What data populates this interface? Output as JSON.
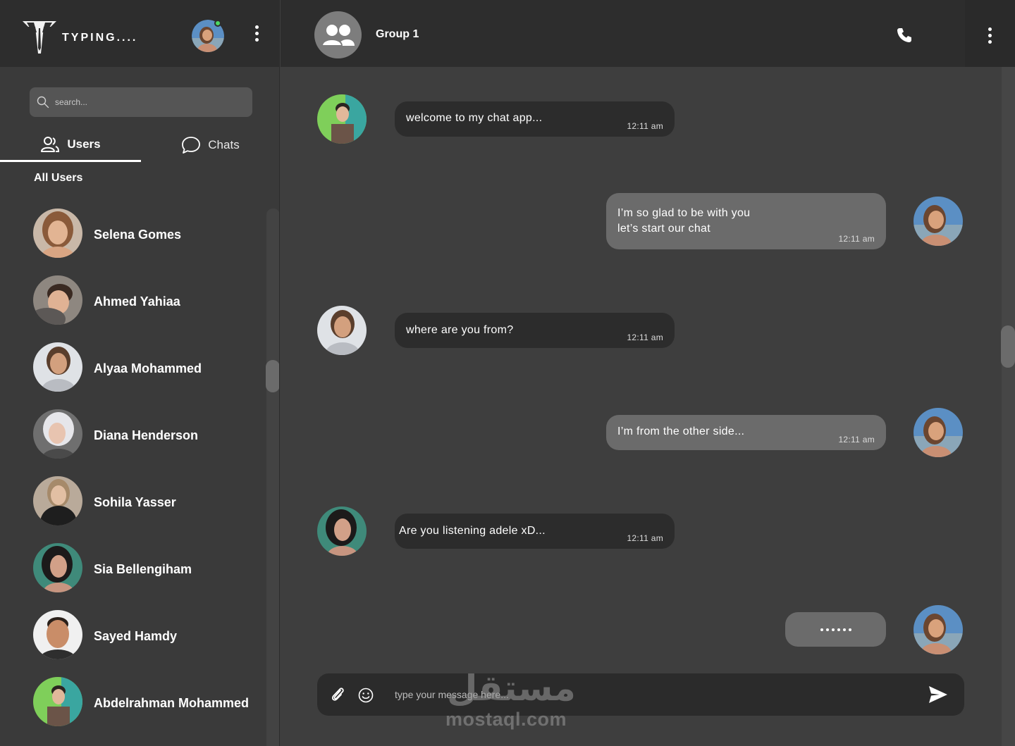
{
  "app": {
    "brand": "TYPING....",
    "online_color": "#4cd964"
  },
  "sidebar": {
    "search": {
      "placeholder": "search..."
    },
    "tabs": [
      {
        "label": "Users",
        "icon": "users-icon",
        "active": true
      },
      {
        "label": "Chats",
        "icon": "chat-bubble-icon",
        "active": false
      }
    ],
    "section_title": "All Users",
    "users": [
      {
        "name": "Selena Gomes"
      },
      {
        "name": "Ahmed Yahiaa"
      },
      {
        "name": "Alyaa Mohammed"
      },
      {
        "name": "Diana Henderson"
      },
      {
        "name": "Sohila Yasser"
      },
      {
        "name": "Sia Bellengiham"
      },
      {
        "name": "Sayed Hamdy"
      },
      {
        "name": "Abdelrahman Mohammed"
      }
    ]
  },
  "chat": {
    "title": "Group 1",
    "messages": [
      {
        "direction": "incoming",
        "text": "welcome to my chat app...",
        "time": "12:11 am"
      },
      {
        "direction": "outgoing",
        "text": "I’m so glad to be with you\nlet’s start our chat",
        "time": "12:11 am"
      },
      {
        "direction": "incoming",
        "text": "where are you from?",
        "time": "12:11 am"
      },
      {
        "direction": "outgoing",
        "text": "I’m from the other side...",
        "time": "12:11 am"
      },
      {
        "direction": "incoming",
        "text": "Are you listening adele xD...",
        "time": "12:11 am"
      }
    ],
    "typing_indicator": "......",
    "composer": {
      "placeholder": "type your message here..."
    }
  },
  "watermark": {
    "arabic": "مستقل",
    "latin": "mostaql.com"
  }
}
